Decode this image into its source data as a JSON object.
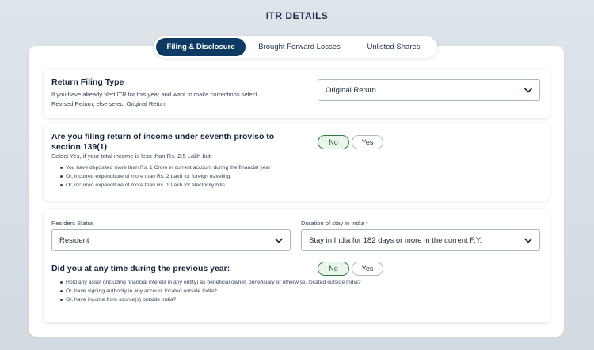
{
  "page": {
    "title": "ITR DETAILS"
  },
  "tabs": [
    {
      "label": "Filing & Disclosure",
      "active": true
    },
    {
      "label": "Brought Forward Losses",
      "active": false
    },
    {
      "label": "Unlisted Shares",
      "active": false
    }
  ],
  "return_filing": {
    "title": "Return Filing Type",
    "description_line1": "If you have already filed ITR for this year and want to make corrections select",
    "description_line2": "Revised Return, else select Original Return",
    "selected": "Original Return"
  },
  "seventh_proviso": {
    "title_line1": "Are you filing return of income under seventh proviso to",
    "title_line2": "section 139(1)",
    "subtitle": "Select Yes, if your total income is less than Rs. 2.5 Lakh but:",
    "bullets": [
      "You have deposited more than Rs. 1 Crore in current account during the financial year",
      "Or, incurred expenditure of more than Rs. 2 Lakh for foreign traveling",
      "Or, incurred expenditure of more than Rs. 1 Lakh for electricity bills"
    ],
    "no_label": "No",
    "yes_label": "Yes",
    "selected": "No"
  },
  "residency": {
    "status_label": "Resident Status",
    "status_value": "Resident",
    "duration_label": "Duration of stay in India",
    "duration_required": "*",
    "duration_value": "Stay in India for 182 days or more in the current F.Y."
  },
  "foreign_assets": {
    "title": "Did you at any time during the previous year:",
    "bullets": [
      "Hold any asset (including financial interest in any entity) as beneficial owner, beneficiary or otherwise, located outside India?",
      "Or, have signing authority in any account located outside India?",
      "Or, have income from source(s) outside India?"
    ],
    "no_label": "No",
    "yes_label": "Yes",
    "selected": "No"
  },
  "colors": {
    "active_tab": "#0d3a63",
    "selected_pill_border": "#2d7a3d",
    "selected_pill_bg": "#eaf6ec",
    "required": "#c0392b"
  },
  "icons": {
    "dropdown": "chevron-down-icon"
  }
}
